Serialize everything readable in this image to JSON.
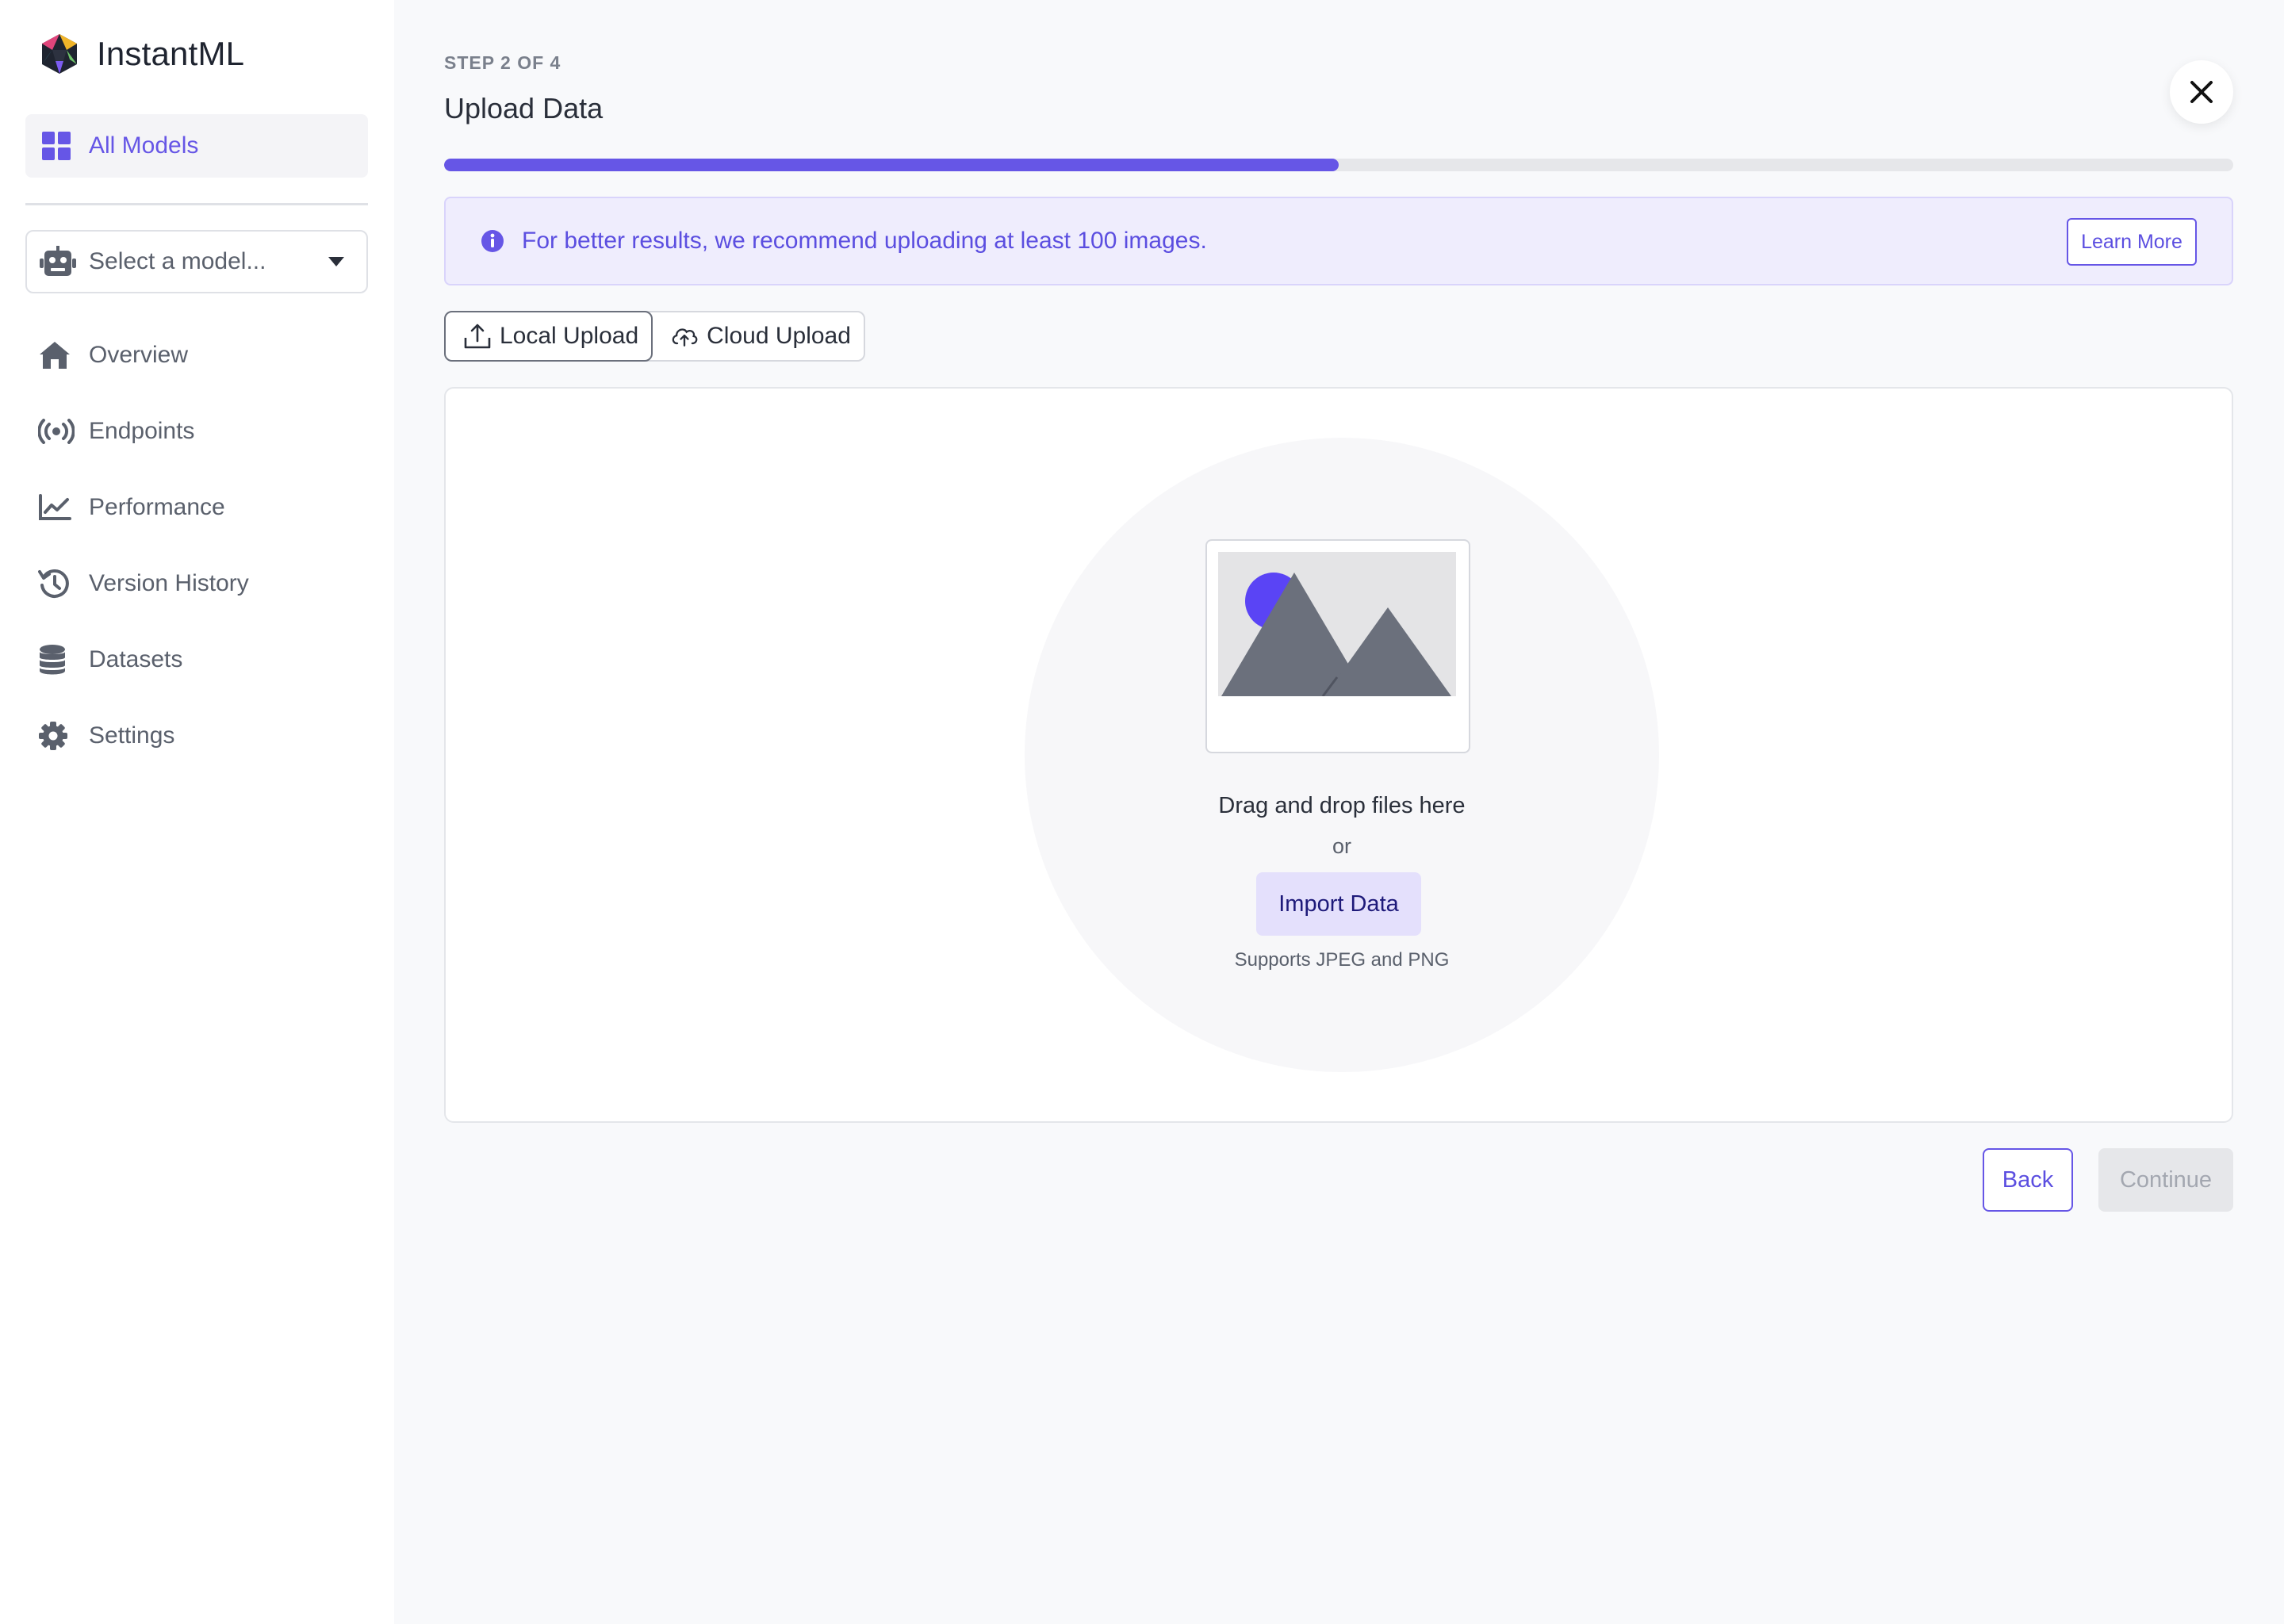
{
  "app": {
    "name": "InstantML",
    "accent_color": "#6656e6"
  },
  "sidebar": {
    "active_item": {
      "label": "All Models",
      "icon": "grid-icon"
    },
    "model_select": {
      "value": "Select a model...",
      "icon": "robot-icon"
    },
    "items": [
      {
        "label": "Overview",
        "icon": "home-icon"
      },
      {
        "label": "Endpoints",
        "icon": "broadcast-icon"
      },
      {
        "label": "Performance",
        "icon": "chart-line-icon"
      },
      {
        "label": "Version History",
        "icon": "history-icon"
      },
      {
        "label": "Datasets",
        "icon": "database-icon"
      },
      {
        "label": "Settings",
        "icon": "gear-icon"
      }
    ]
  },
  "wizard": {
    "step_label": "STEP 2 OF 4",
    "title": "Upload Data",
    "progress_fraction": 0.5
  },
  "alert": {
    "text": "For better results, we recommend uploading at least 100 images.",
    "action_label": "Learn More",
    "icon": "info-icon"
  },
  "tabs": [
    {
      "label": "Local Upload",
      "icon": "upload-icon",
      "active": true
    },
    {
      "label": "Cloud Upload",
      "icon": "cloud-upload-icon",
      "active": false
    }
  ],
  "dropzone": {
    "title": "Drag and drop files here",
    "or_text": "or",
    "button_label": "Import Data",
    "hint": "Supports JPEG and PNG",
    "illustration": "image-placeholder-icon"
  },
  "footer": {
    "back_label": "Back",
    "continue_label": "Continue"
  }
}
